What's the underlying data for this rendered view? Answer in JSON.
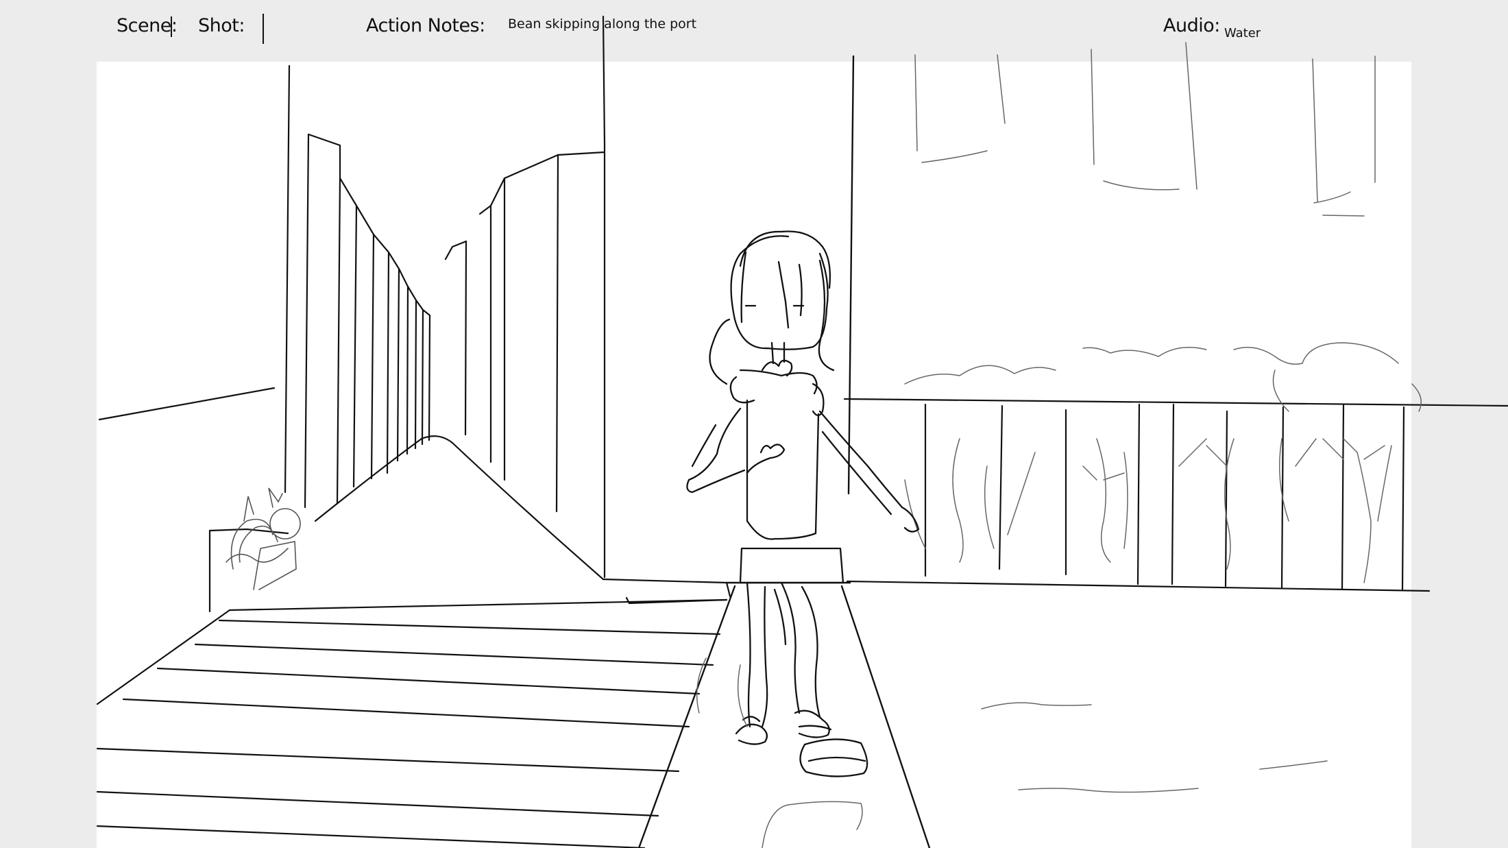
{
  "header": {
    "scene_label": "Scene:",
    "scene_value": "",
    "shot_label": "Shot:",
    "shot_value": "",
    "action_notes_label": "Action Notes:",
    "action_notes_value": "Bean skipping along the port",
    "audio_label": "Audio:",
    "audio_value": "Water"
  },
  "colors": {
    "background": "#ececec",
    "panel": "#ffffff",
    "ink": "#111111",
    "pencil": "#444444"
  },
  "panel": {
    "content": "storyboard-sketch"
  }
}
